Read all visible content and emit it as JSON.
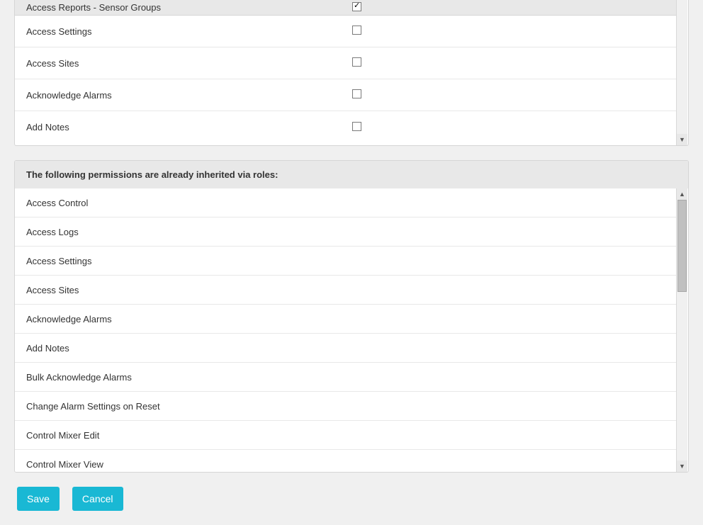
{
  "topPermissions": [
    {
      "label": "Access Reports - Sensor Groups",
      "checked": true
    },
    {
      "label": "Access Settings",
      "checked": false
    },
    {
      "label": "Access Sites",
      "checked": false
    },
    {
      "label": "Acknowledge Alarms",
      "checked": false
    },
    {
      "label": "Add Notes",
      "checked": false
    }
  ],
  "inheritedHeader": "The following permissions are already inherited via roles:",
  "inheritedPermissions": [
    "Access Control",
    "Access Logs",
    "Access Settings",
    "Access Sites",
    "Acknowledge Alarms",
    "Add Notes",
    "Bulk Acknowledge Alarms",
    "Change Alarm Settings on Reset",
    "Control Mixer Edit",
    "Control Mixer View"
  ],
  "buttons": {
    "save": "Save",
    "cancel": "Cancel"
  }
}
